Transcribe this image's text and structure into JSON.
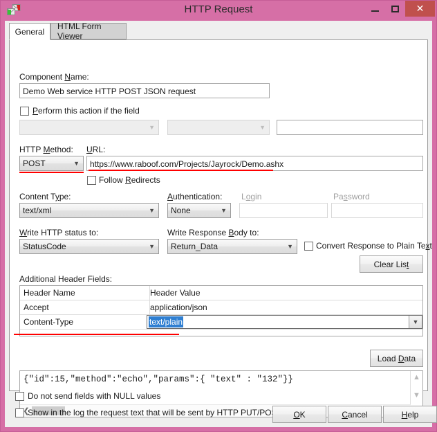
{
  "window": {
    "title": "HTTP Request",
    "icon": "mail-request-icon",
    "minimize_label": "Minimize",
    "maximize_label": "Maximize",
    "close_label": "✕",
    "titlebar_color": "#d66fa6",
    "close_button_color": "#c0504d"
  },
  "tabs": [
    {
      "label": "General",
      "active": true
    },
    {
      "label": "HTML Form Viewer",
      "active": false
    }
  ],
  "form": {
    "component_name_label": "Component Name:",
    "component_name_value": "Demo Web service HTTP POST JSON request",
    "perform_action_label": "Perform this action if the field",
    "perform_action_checked": false,
    "condition_field_value": "",
    "condition_operator_value": "",
    "condition_value_value": "",
    "http_method_label": "HTTP Method:",
    "http_method_value": "POST",
    "url_label": "URL:",
    "url_value": "https://www.raboof.com/Projects/Jayrock/Demo.ashx",
    "follow_redirects_label": "Follow Redirects",
    "follow_redirects_checked": false,
    "content_type_label": "Content Type:",
    "content_type_value": "text/xml",
    "authentication_label": "Authentication:",
    "authentication_value": "None",
    "login_label": "Login",
    "login_value": "",
    "password_label": "Password",
    "password_value": "",
    "write_status_label": "Write HTTP status to:",
    "write_status_value": "StatusCode",
    "write_body_label": "Write Response Body to:",
    "write_body_value": "Return_Data",
    "convert_plain_label": "Convert Response to Plain Text",
    "convert_plain_checked": false,
    "clear_list_label": "Clear List",
    "additional_headers_label": "Additional Header Fields:",
    "load_data_label": "Load Data"
  },
  "header_grid": {
    "columns": [
      "Header Name",
      "Header Value"
    ],
    "rows": [
      {
        "name": "Accept",
        "value": "application/json",
        "editing": false
      },
      {
        "name": "Content-Type",
        "value": "text/plain",
        "editing": true
      }
    ]
  },
  "body": {
    "text": "{\"id\":15,\"method\":\"echo\",\"params\":{ \"text\" : \"132\"}}"
  },
  "options": {
    "no_null_fields_label": "Do not send fields with NULL values",
    "no_null_fields_checked": false,
    "show_in_log_label": "Show in the log the request text that will be sent by HTTP PUT/POST",
    "show_in_log_checked": false
  },
  "actions": {
    "ok_label": "OK",
    "cancel_label": "Cancel",
    "help_label": "Help"
  },
  "annotations": {
    "highlight_color": "#ff0000",
    "selection_color": "#2f7fd2"
  }
}
